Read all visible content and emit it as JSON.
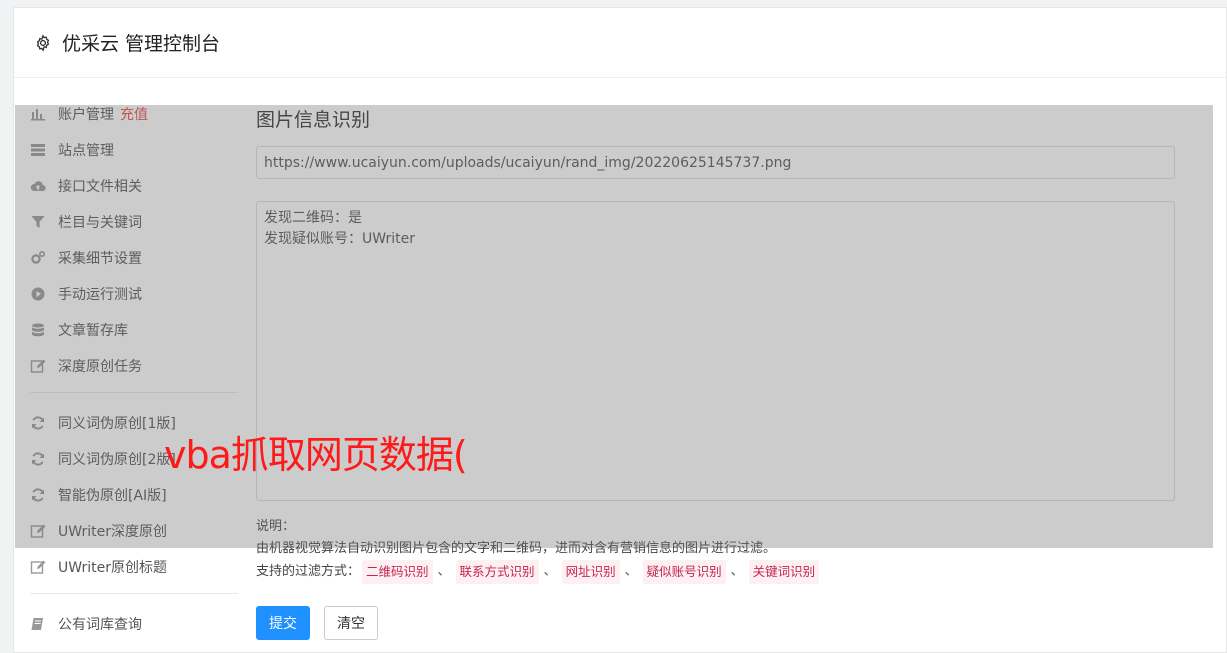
{
  "header": {
    "title": "优采云 管理控制台"
  },
  "sidebar": {
    "group1": [
      {
        "label": "账户管理",
        "badge": "充值",
        "icon": "bar-chart-icon"
      },
      {
        "label": "站点管理",
        "icon": "server-icon"
      },
      {
        "label": "接口文件相关",
        "icon": "cloud-upload-icon"
      },
      {
        "label": "栏目与关键词",
        "icon": "filter-icon"
      },
      {
        "label": "采集细节设置",
        "icon": "cogs-icon"
      },
      {
        "label": "手动运行测试",
        "icon": "play-circle-icon"
      },
      {
        "label": "文章暂存库",
        "icon": "database-icon"
      },
      {
        "label": "深度原创任务",
        "icon": "edit-icon"
      }
    ],
    "group2": [
      {
        "label": "同义词伪原创[1版]",
        "icon": "refresh-icon"
      },
      {
        "label": "同义词伪原创[2版]",
        "icon": "refresh-icon"
      },
      {
        "label": "智能伪原创[AI版]",
        "icon": "refresh-icon"
      },
      {
        "label": "UWriter深度原创",
        "icon": "edit-icon"
      },
      {
        "label": "UWriter原创标题",
        "icon": "edit-icon"
      }
    ],
    "group3": [
      {
        "label": "公有词库查询",
        "icon": "book-icon"
      }
    ]
  },
  "main": {
    "title": "图片信息识别",
    "url_value": "https://www.ucaiyun.com/uploads/ucaiyun/rand_img/20220625145737.png",
    "result_lines": [
      "发现二维码：是",
      "发现疑似账号：UWriter"
    ],
    "desc_label": "说明：",
    "desc_text": "由机器视觉算法自动识别图片包含的文字和二维码，进而对含有营销信息的图片进行过滤。",
    "filter_label": "支持的过滤方式：",
    "filter_tags": [
      "二维码识别",
      "联系方式识别",
      "网址识别",
      "疑似账号识别",
      "关键词识别"
    ],
    "separator": "、",
    "submit_label": "提交",
    "clear_label": "清空"
  },
  "watermark": "vba抓取网页数据(",
  "colors": {
    "primary": "#1e90ff",
    "badge": "#e64c4c",
    "tag_text": "#c7254e",
    "watermark": "#ff1a1a"
  }
}
